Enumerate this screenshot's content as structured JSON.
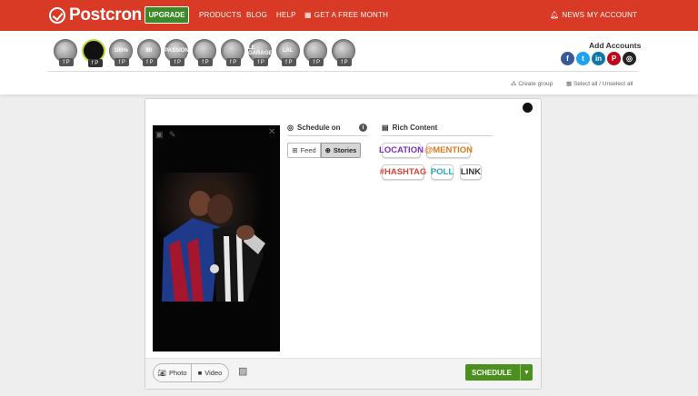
{
  "nav": {
    "brand": "Postcron",
    "upgrade_label": "UPGRADE",
    "products": "PRODUCTS",
    "blog": "BLOG",
    "help": "HELP",
    "free_month": "GET A FREE MONTH",
    "news": "NEWS",
    "my_account": "MY ACCOUNT",
    "bar_color": "#d93a26"
  },
  "accounts": {
    "add_accounts_label": "Add Accounts",
    "items": [
      {
        "badge": ""
      },
      {
        "badge": "",
        "selected": true
      },
      {
        "badge": "100%"
      },
      {
        "badge": "80"
      },
      {
        "badge": "PASSION"
      },
      {
        "badge": ""
      },
      {
        "badge": ""
      },
      {
        "badge": "LE GARAGE"
      },
      {
        "badge": "LAL"
      },
      {
        "badge": ""
      },
      {
        "badge": ""
      }
    ],
    "networks": [
      {
        "name": "facebook-icon",
        "glyph": "f",
        "color": "#3b5998"
      },
      {
        "name": "twitter-icon",
        "glyph": "t",
        "color": "#1da1f2"
      },
      {
        "name": "linkedin-icon",
        "glyph": "in",
        "color": "#0e76a8"
      },
      {
        "name": "pinterest-icon",
        "glyph": "P",
        "color": "#bd081c"
      },
      {
        "name": "instagram-icon",
        "glyph": "◎",
        "color": "#222222"
      }
    ],
    "create_group": "Create group",
    "select_all": "Select all / Unselect all"
  },
  "composer": {
    "schedule_on_title": "Schedule on",
    "feed_label": "Feed",
    "stories_label": "Stories",
    "rich_content_title": "Rich Content",
    "stickers": [
      {
        "text": "LOCATION",
        "color": "#7b2fbf"
      },
      {
        "text": "@MENTION",
        "color": "#e07b1c"
      },
      {
        "text": "#HASHTAG",
        "color": "#d9463a"
      },
      {
        "text": "POLL",
        "color": "#2aa7b8"
      },
      {
        "text": "LINK",
        "color": "#333333"
      }
    ],
    "photo_label": "Photo",
    "video_label": "Video",
    "schedule_label": "SCHEDULE"
  }
}
